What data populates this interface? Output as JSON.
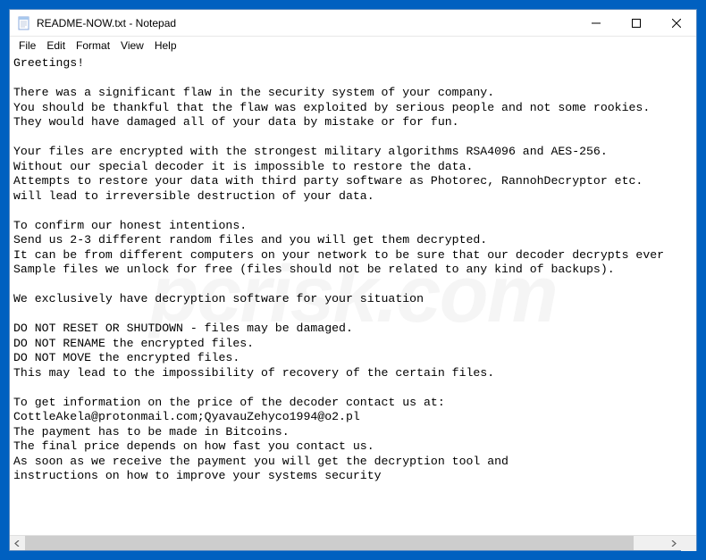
{
  "titlebar": {
    "title": "README-NOW.txt - Notepad"
  },
  "menu": {
    "file": "File",
    "edit": "Edit",
    "format": "Format",
    "view": "View",
    "help": "Help"
  },
  "content": {
    "text": "Greetings!\n\nThere was a significant flaw in the security system of your company.\nYou should be thankful that the flaw was exploited by serious people and not some rookies.\nThey would have damaged all of your data by mistake or for fun.\n\nYour files are encrypted with the strongest military algorithms RSA4096 and AES-256.\nWithout our special decoder it is impossible to restore the data.\nAttempts to restore your data with third party software as Photorec, RannohDecryptor etc.\nwill lead to irreversible destruction of your data.\n\nTo confirm our honest intentions.\nSend us 2-3 different random files and you will get them decrypted.\nIt can be from different computers on your network to be sure that our decoder decrypts ever\nSample files we unlock for free (files should not be related to any kind of backups).\n\nWe exclusively have decryption software for your situation\n\nDO NOT RESET OR SHUTDOWN - files may be damaged.\nDO NOT RENAME the encrypted files.\nDO NOT MOVE the encrypted files.\nThis may lead to the impossibility of recovery of the certain files.\n\nTo get information on the price of the decoder contact us at:\nCottleAkela@protonmail.com;QyavauZehyco1994@o2.pl\nThe payment has to be made in Bitcoins.\nThe final price depends on how fast you contact us.\nAs soon as we receive the payment you will get the decryption tool and\ninstructions on how to improve your systems security"
  },
  "watermark": "pcrisk.com"
}
